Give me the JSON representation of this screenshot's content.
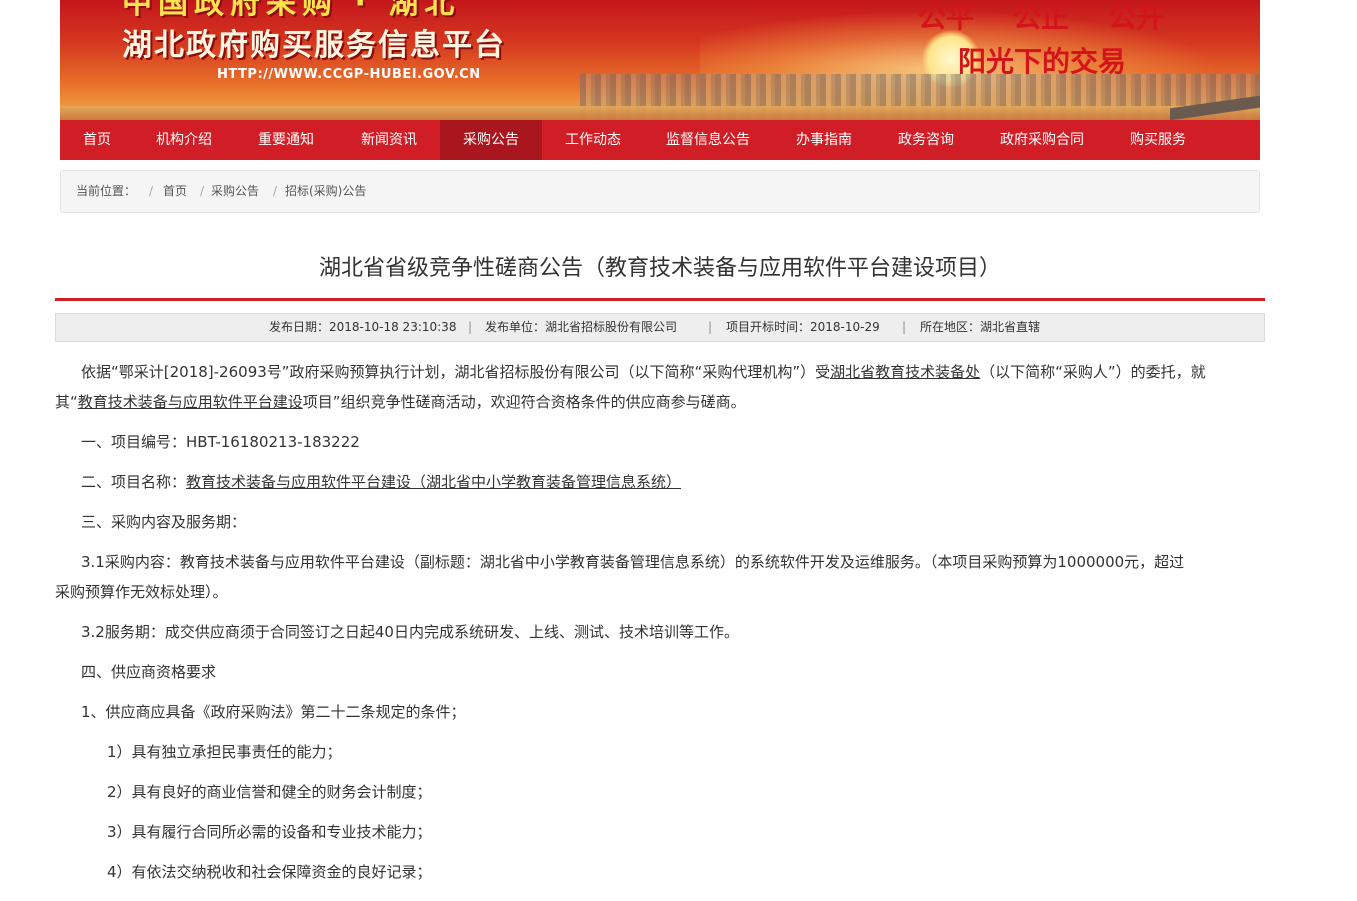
{
  "banner": {
    "title_line1": "中国政府采购 · 湖北",
    "title_line2": "湖北政府购买服务信息平台",
    "url": "HTTP://WWW.CCGP-HUBEI.GOV.CN",
    "slogan1": "公平    公正    公开",
    "slogan2": "阳光下的交易"
  },
  "nav": {
    "items": [
      "首页",
      "机构介绍",
      "重要通知",
      "新闻资讯",
      "采购公告",
      "工作动态",
      "监督信息公告",
      "办事指南",
      "政务咨询",
      "政府采购合同",
      "购买服务"
    ],
    "active": "采购公告"
  },
  "breadcrumb": {
    "label": "当前位置：",
    "sep": "/",
    "items": [
      "首页",
      "采购公告",
      "招标(采购)公告"
    ]
  },
  "article": {
    "title": "湖北省省级竞争性磋商公告（教育技术装备与应用软件平台建设项目）",
    "meta": {
      "publish_date": "发布日期：2018-10-18 23:10:38",
      "publisher": "发布单位：湖北省招标股份有限公司",
      "open_date": "项目开标时间：2018-10-29",
      "region": "所在地区：湖北省直辖",
      "sep": "|"
    },
    "para1": {
      "a": "依据“鄂采计[2018]-26093号”政府采购预算执行计划，湖北省招标股份有限公司（以下简称“采购代理机构”）受",
      "b": "湖北省教育技术装备处",
      "c": "（以下简称“采购人”）的委托，就",
      "d": "其“",
      "e": "教育技术装备与应用软件平台建设",
      "f": "项目”组织竞争性磋商活动，欢迎符合资格条件的供应商参与磋商。"
    },
    "item1": "一、项目编号：HBT-16180213-183222",
    "item2_prefix": "二、项目名称：",
    "item2_link": "教育技术装备与应用软件平台建设（湖北省中小学教育装备管理信息系统）",
    "item3": "三、采购内容及服务期：",
    "item3_1a": "3.1采购内容：教育技术装备与应用软件平台建设（副标题：湖北省中小学教育装备管理信息系统）的系统软件开发及运维服务。（本项目采购预算为1000000元，超过",
    "item3_1b": "采购预算作无效标处理）。",
    "item3_2": "3.2服务期：成交供应商须于合同签订之日起40日内完成系统研发、上线、测试、技术培训等工作。",
    "item4": "四、供应商资格要求",
    "item4_1": "1、供应商应具备《政府采购法》第二十二条规定的条件；",
    "sub": [
      "1）具有独立承担民事责任的能力；",
      "2）具有良好的商业信誉和健全的财务会计制度；",
      "3）具有履行合同所必需的设备和专业技术能力；",
      "4）有依法交纳税收和社会保障资金的良好记录；"
    ]
  },
  "colors": {
    "brand_red": "#d01d26",
    "nav_active": "#a9161d",
    "slogan": "#d3141a"
  }
}
